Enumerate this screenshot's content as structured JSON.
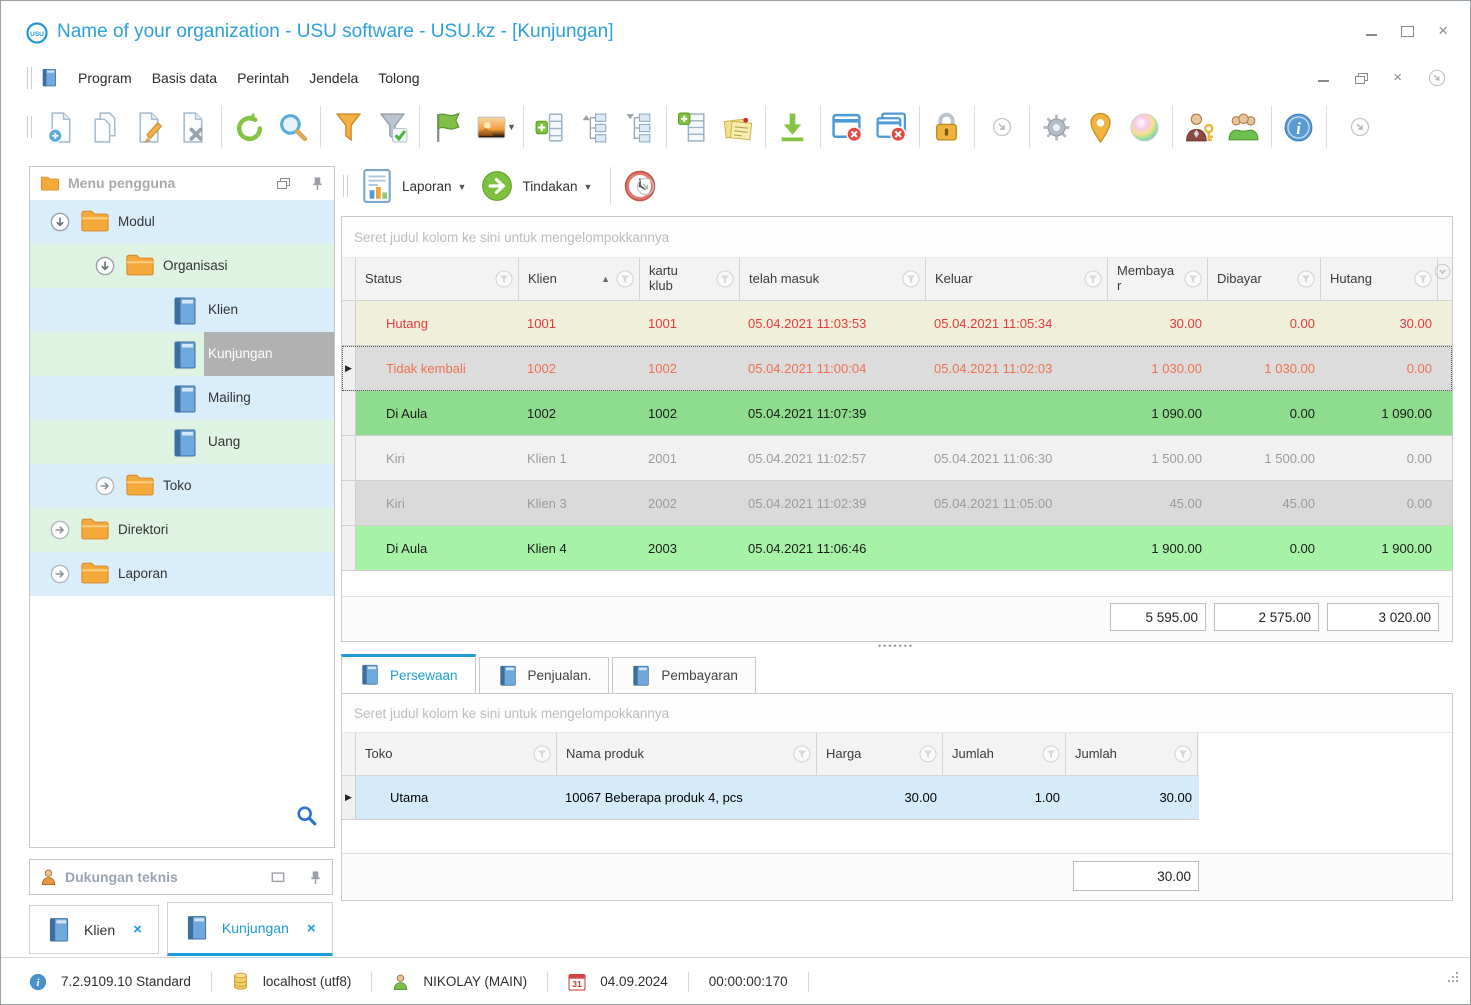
{
  "window": {
    "title": "Name of your organization - USU software - USU.kz - [Kunjungan]",
    "logo": "USU"
  },
  "menu": {
    "items": [
      "Program",
      "Basis data",
      "Perintah",
      "Jendela",
      "Tolong"
    ]
  },
  "toolbar": {
    "groups": [
      [
        "doc-new",
        "doc-copy",
        "doc-edit",
        "doc-delete"
      ],
      [
        "refresh",
        "search"
      ],
      [
        "filter",
        "filter-check"
      ],
      [
        "flag",
        "image"
      ],
      [
        "detail-add",
        "tree-expand",
        "tree-collapse"
      ],
      [
        "row-add",
        "notes"
      ],
      [
        "download"
      ],
      [
        "window-close",
        "windows-close-all"
      ],
      [
        "lock"
      ],
      [
        "toolbar-options"
      ],
      [
        "settings",
        "location",
        "palette"
      ],
      [
        "user-permissions",
        "users"
      ],
      [
        "about"
      ],
      [
        "toolbar-options-2"
      ]
    ]
  },
  "report_toolbar": {
    "laporan_label": "Laporan",
    "tindakan_label": "Tindakan"
  },
  "sidebar": {
    "header": "Menu pengguna",
    "support_header": "Dukungan teknis",
    "tree": [
      {
        "label": "Modul",
        "icon": "folder",
        "expander": "expanded",
        "level": 0
      },
      {
        "label": "Organisasi",
        "icon": "folder",
        "expander": "expanded",
        "level": 1
      },
      {
        "label": "Klien",
        "icon": "book",
        "level": 2
      },
      {
        "label": "Kunjungan",
        "icon": "book",
        "level": 2,
        "selected": true
      },
      {
        "label": "Mailing",
        "icon": "book",
        "level": 2
      },
      {
        "label": "Uang",
        "icon": "book",
        "level": 2
      },
      {
        "label": "Toko",
        "icon": "folder",
        "expander": "collapsed",
        "level": 1
      },
      {
        "label": "Direktori",
        "icon": "folder",
        "expander": "collapsed",
        "level": 0
      },
      {
        "label": "Laporan",
        "icon": "folder",
        "expander": "collapsed",
        "level": 0
      }
    ]
  },
  "mdi_tabs": [
    {
      "label": "Klien",
      "active": false
    },
    {
      "label": "Kunjungan",
      "active": true
    }
  ],
  "visits": {
    "group_hint": "Seret judul kolom ke sini untuk mengelompokkannya",
    "columns": [
      "Status",
      "Klien",
      "kartu klub",
      "telah masuk",
      "Keluar",
      "Membayar",
      "Dibayar",
      "Hutang"
    ],
    "sorted_column": "Klien",
    "rows": [
      {
        "status": "Hutang",
        "klien": "1001",
        "kartu_klub": "1001",
        "telah_masuk": "05.04.2021 11:03:53",
        "keluar": "05.04.2021 11:05:34",
        "membayar": "30.00",
        "dibayar": "0.00",
        "hutang": "30.00",
        "style": "debt",
        "selected": false
      },
      {
        "status": "Tidak kembali",
        "klien": "1002",
        "kartu_klub": "1002",
        "telah_masuk": "05.04.2021 11:00:04",
        "keluar": "05.04.2021 11:02:03",
        "membayar": "1 030.00",
        "dibayar": "1 030.00",
        "hutang": "0.00",
        "style": "not-returned",
        "selected": true
      },
      {
        "status": "Di Aula",
        "klien": "1002",
        "kartu_klub": "1002",
        "telah_masuk": "05.04.2021 11:07:39",
        "keluar": "",
        "membayar": "1 090.00",
        "dibayar": "0.00",
        "hutang": "1 090.00",
        "style": "in-hall",
        "selected": false
      },
      {
        "status": "Kiri",
        "klien": "Klien 1",
        "kartu_klub": "2001",
        "telah_masuk": "05.04.2021 11:02:57",
        "keluar": "05.04.2021 11:06:30",
        "membayar": "1 500.00",
        "dibayar": "1 500.00",
        "hutang": "0.00",
        "style": "left",
        "selected": false
      },
      {
        "status": "Kiri",
        "klien": "Klien 3",
        "kartu_klub": "2002",
        "telah_masuk": "05.04.2021 11:02:39",
        "keluar": "05.04.2021 11:05:00",
        "membayar": "45.00",
        "dibayar": "45.00",
        "hutang": "0.00",
        "style": "left",
        "selected": false
      },
      {
        "status": "Di Aula",
        "klien": "Klien 4",
        "kartu_klub": "2003",
        "telah_masuk": "05.04.2021 11:06:46",
        "keluar": "",
        "membayar": "1 900.00",
        "dibayar": "0.00",
        "hutang": "1 900.00",
        "style": "in-hall-light",
        "selected": false
      }
    ],
    "totals": {
      "membayar": "5 595.00",
      "dibayar": "2 575.00",
      "hutang": "3 020.00"
    }
  },
  "detail": {
    "tabs": [
      {
        "label": "Persewaan",
        "active": true
      },
      {
        "label": "Penjualan.",
        "active": false
      },
      {
        "label": "Pembayaran",
        "active": false
      }
    ],
    "group_hint": "Seret judul kolom ke sini untuk mengelompokkannya",
    "columns": [
      "Toko",
      "Nama produk",
      "Harga",
      "Jumlah",
      "Jumlah"
    ],
    "rows": [
      {
        "toko": "Utama",
        "nama_produk": "10067 Beberapa produk 4, pcs",
        "harga": "30.00",
        "jumlah": "1.00",
        "jumlah_total": "30.00",
        "selected": true
      }
    ],
    "total": "30.00"
  },
  "statusbar": {
    "version": "7.2.9109.10 Standard",
    "database": "localhost (utf8)",
    "user": "NIKOLAY (MAIN)",
    "calendar_day": "31",
    "date": "04.09.2024",
    "timer": "00:00:00:170"
  },
  "colors": {
    "accent_blue": "#1e9cdb",
    "title_blue": "#2ba0da",
    "row_debt_bg": "#f0efd9",
    "row_debt_text": "#e8393d",
    "row_not_returned_bg": "#dcdcdc",
    "row_not_returned_text": "#ef7150",
    "row_in_hall_bg": "#8edc8e",
    "row_in_hall_light_bg": "#a6f2a6",
    "row_left_text": "#9b9b9b",
    "detail_selected_row_bg": "#d6ebfa",
    "tree_blue": "#d9edfb",
    "tree_green": "#def3e1",
    "tree_selected": "#b1b1b1"
  }
}
